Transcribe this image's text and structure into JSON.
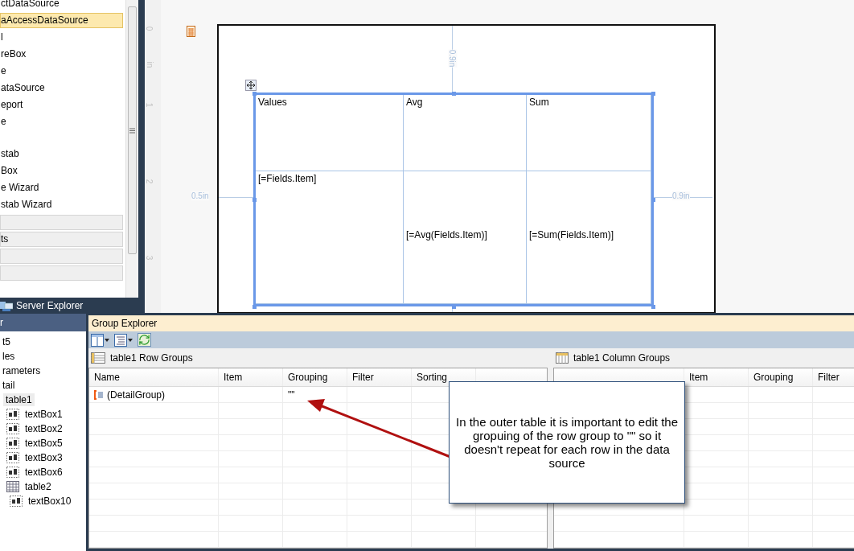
{
  "toolbox": {
    "items": [
      {
        "label": "ctDataSource",
        "selected": false
      },
      {
        "label": "aAccessDataSource",
        "selected": true
      },
      {
        "label": "l",
        "selected": false
      },
      {
        "label": "reBox",
        "selected": false
      },
      {
        "label": "e",
        "selected": false
      },
      {
        "label": "ataSource",
        "selected": false
      },
      {
        "label": "eport",
        "selected": false
      },
      {
        "label": "e",
        "selected": false
      },
      {
        "label": "stab",
        "selected": false
      },
      {
        "label": "Box",
        "selected": false
      },
      {
        "label": "e Wizard",
        "selected": false
      },
      {
        "label": "stab Wizard",
        "selected": false
      }
    ],
    "categories": [
      {
        "expanded": false
      },
      {
        "label": "ts",
        "expanded": false
      },
      {
        "expanded": false
      },
      {
        "expanded": false
      }
    ]
  },
  "server_explorer_tab": {
    "label": "Server Explorer"
  },
  "document_outline": {
    "title": "r",
    "tree": [
      {
        "label": "t5",
        "selected": false
      },
      {
        "label": "les",
        "selected": false
      },
      {
        "label": "rameters",
        "selected": false
      },
      {
        "label": "tail",
        "selected": false,
        "children": [
          {
            "label": "table1",
            "selected": true,
            "children": [
              {
                "label": "textBox1",
                "kind": "textbox",
                "selected": false
              },
              {
                "label": "textBox2",
                "kind": "textbox",
                "selected": false
              },
              {
                "label": "textBox5",
                "kind": "textbox",
                "selected": false
              },
              {
                "label": "textBox3",
                "kind": "textbox",
                "selected": false
              },
              {
                "label": "textBox6",
                "kind": "textbox",
                "selected": false
              },
              {
                "label": "table2",
                "kind": "table",
                "selected": false,
                "children": [
                  {
                    "label": "textBox10",
                    "kind": "textbox",
                    "selected": false
                  }
                ]
              }
            ]
          }
        ]
      }
    ]
  },
  "designer": {
    "ruler": [
      "0",
      "in",
      "1",
      "2",
      "3"
    ],
    "margins": {
      "top": "0.9in",
      "left": "0.5in",
      "right": "0.9in"
    },
    "table": {
      "selected": true,
      "rows": [
        [
          "Values",
          "Avg",
          "Sum"
        ],
        [
          "[=Fields.Item]",
          "[=Avg(Fields.Item)]",
          "[=Sum(Fields.Item)]"
        ]
      ]
    }
  },
  "group_explorer": {
    "title": "Group Explorer",
    "row_groups": {
      "title": "table1 Row Groups",
      "columns": [
        {
          "label": "Name"
        },
        {
          "label": "Item"
        },
        {
          "label": "Grouping"
        },
        {
          "label": "Filter"
        },
        {
          "label": "Sorting"
        },
        {}
      ],
      "rows": [
        {
          "name": "(DetailGroup)",
          "grouping": "\"\""
        }
      ]
    },
    "column_groups": {
      "title": "table1 Column Groups",
      "columns": [
        {},
        {
          "label": "Item"
        },
        {
          "label": "Grouping"
        },
        {
          "label": "Filter"
        }
      ]
    }
  },
  "callout": {
    "text": "In the outer table it is important to edit the gropuing of the row group to \"\" so it doesn't repeat for each row in the data source"
  }
}
